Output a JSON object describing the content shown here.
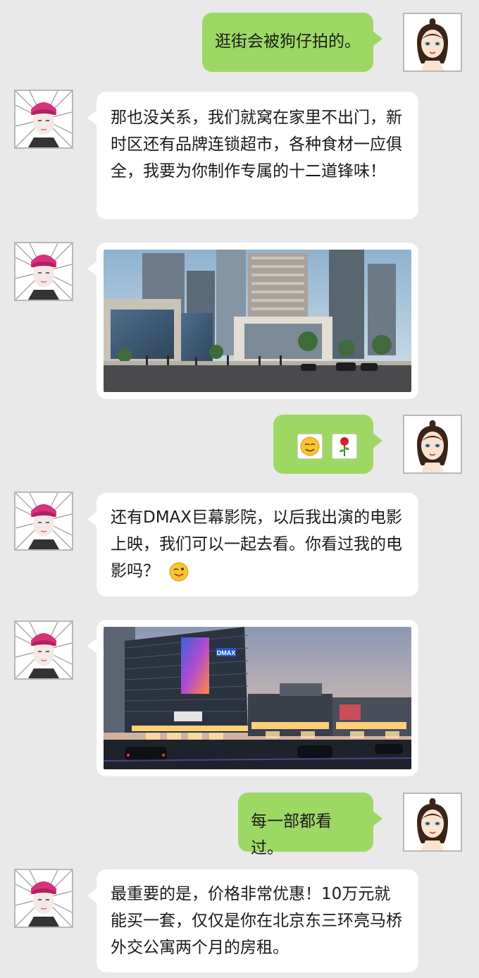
{
  "messages": [
    {
      "sender": "female",
      "text": "逛街会被狗仔拍的。"
    },
    {
      "sender": "male",
      "text": "那也没关系，我们就窝在家里不出门，新时区还有品牌连锁超市，各种食材一应俱全，我要为你制作专属的十二道锋味！"
    },
    {
      "sender": "male",
      "image": "building-photo-day"
    },
    {
      "sender": "female",
      "emojis": [
        "grin-emoji",
        "rose-emoji"
      ]
    },
    {
      "sender": "male",
      "text": "还有DMAX巨幕影院，以后我出演的电影上映，我们可以一起去看。你看过我的电影吗？",
      "emoji": "tongue-wink-emoji"
    },
    {
      "sender": "male",
      "image": "cinema-mall-photo-night",
      "sign_text": "DMAX"
    },
    {
      "sender": "female",
      "text": "每一部都看过。"
    },
    {
      "sender": "male",
      "text": "最重要的是，价格非常优惠！10万元就能买一套，仅仅是你在北京东三环亮马桥外交公寓两个月的房租。"
    }
  ],
  "colors": {
    "background": "#e9e9e9",
    "bubble_white": "#ffffff",
    "bubble_green": "#9dd865"
  }
}
